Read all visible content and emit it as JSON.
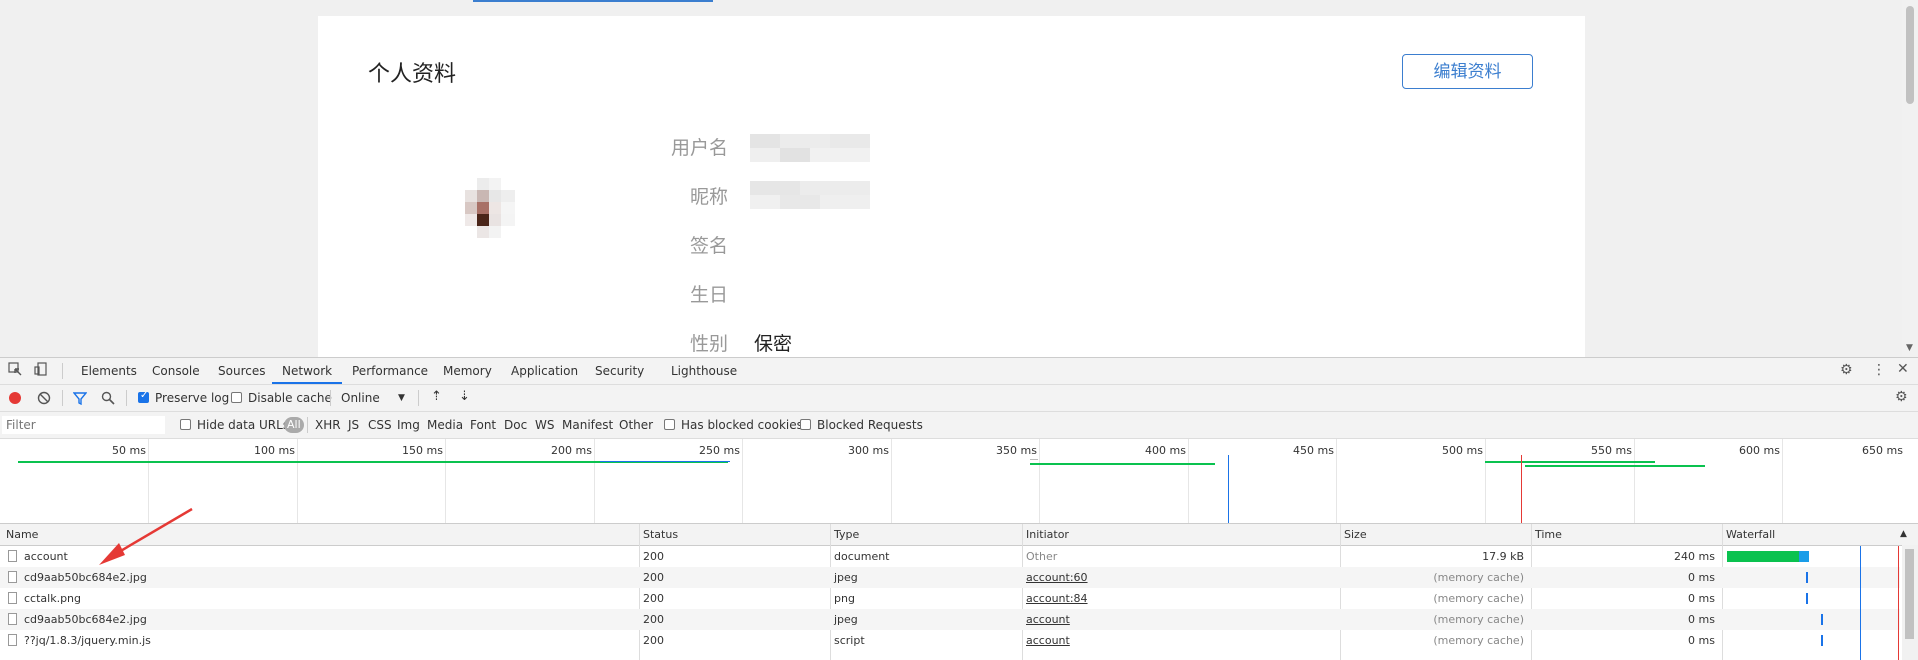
{
  "page": {
    "title": "个人资料",
    "edit_button": "编辑资料",
    "fields": [
      {
        "label": "用户名",
        "value": ""
      },
      {
        "label": "昵称",
        "value": ""
      },
      {
        "label": "签名",
        "value": ""
      },
      {
        "label": "生日",
        "value": ""
      },
      {
        "label": "性别",
        "value": "保密"
      }
    ]
  },
  "devtools": {
    "tabs": [
      "Elements",
      "Console",
      "Sources",
      "Network",
      "Performance",
      "Memory",
      "Application",
      "Security",
      "Lighthouse"
    ],
    "active_tab": "Network",
    "toolbar": {
      "preserve_log": "Preserve log",
      "preserve_log_checked": true,
      "disable_cache": "Disable cache",
      "disable_cache_checked": false,
      "throttle": "Online"
    },
    "filterbar": {
      "filter_placeholder": "Filter",
      "hide_data_urls": "Hide data URLs",
      "types": [
        "All",
        "XHR",
        "JS",
        "CSS",
        "Img",
        "Media",
        "Font",
        "Doc",
        "WS",
        "Manifest",
        "Other"
      ],
      "has_blocked_cookies": "Has blocked cookies",
      "blocked_requests": "Blocked Requests"
    },
    "overview_ticks": [
      "50 ms",
      "100 ms",
      "150 ms",
      "200 ms",
      "250 ms",
      "300 ms",
      "350 ms",
      "400 ms",
      "450 ms",
      "500 ms",
      "550 ms",
      "600 ms",
      "650 ms"
    ],
    "columns": [
      "Name",
      "Status",
      "Type",
      "Initiator",
      "Size",
      "Time",
      "Waterfall"
    ],
    "rows": [
      {
        "name": "account",
        "status": "200",
        "type": "document",
        "initiator": "Other",
        "initiator_link": false,
        "size": "17.9 kB",
        "size_gray": false,
        "time": "240 ms"
      },
      {
        "name": "cd9aab50bc684e2.jpg",
        "status": "200",
        "type": "jpeg",
        "initiator": "account:60",
        "initiator_link": true,
        "size": "(memory cache)",
        "size_gray": true,
        "time": "0 ms"
      },
      {
        "name": "cctalk.png",
        "status": "200",
        "type": "png",
        "initiator": "account:84",
        "initiator_link": true,
        "size": "(memory cache)",
        "size_gray": true,
        "time": "0 ms"
      },
      {
        "name": "cd9aab50bc684e2.jpg",
        "status": "200",
        "type": "jpeg",
        "initiator": "account",
        "initiator_link": true,
        "size": "(memory cache)",
        "size_gray": true,
        "time": "0 ms"
      },
      {
        "name": "??jq/1.8.3/jquery.min.js",
        "status": "200",
        "type": "script",
        "initiator": "account",
        "initiator_link": true,
        "size": "(memory cache)",
        "size_gray": true,
        "time": "0 ms"
      }
    ]
  },
  "colors": {
    "accent": "#1a73e8",
    "edit_button": "#3b7ecf",
    "waterfall_green": "#0ac24f",
    "annotation_arrow": "#e53935"
  }
}
